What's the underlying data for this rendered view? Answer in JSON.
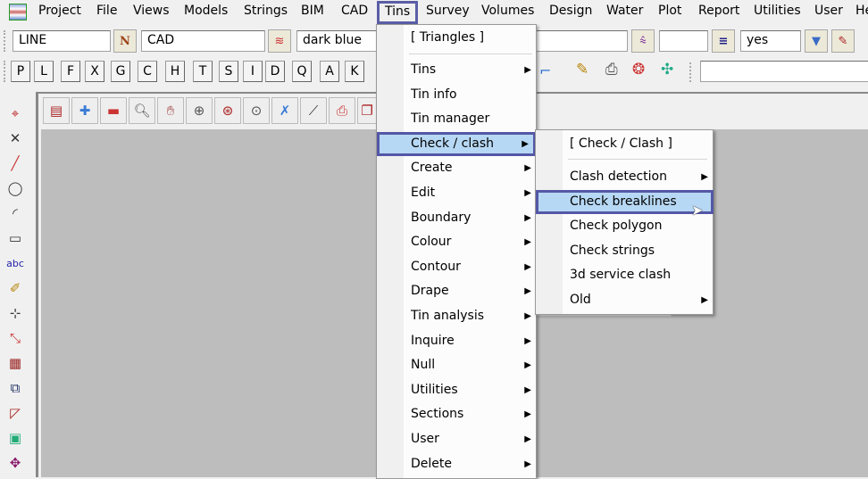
{
  "menubar": {
    "items": [
      "Project",
      "File",
      "Views",
      "Models",
      "Strings",
      "BIM",
      "CAD",
      "Tins",
      "Survey",
      "Volumes",
      "Design",
      "Water",
      "Plot",
      "Report",
      "Utilities",
      "User",
      "He"
    ],
    "active": "Tins"
  },
  "toolbar": {
    "line_value": "LINE",
    "model_value": "CAD",
    "colour_value": "dark blue",
    "flag_value": "yes",
    "n_button": "N"
  },
  "letters": [
    "P",
    "L",
    "F",
    "X",
    "G",
    "C",
    "H",
    "T",
    "S",
    "I",
    "D",
    "Q",
    "A",
    "K"
  ],
  "tins_menu": {
    "title": "[ Triangles ]",
    "items": [
      "Tins",
      "Tin info",
      "Tin manager",
      "Check / clash",
      "Create",
      "Edit",
      "Boundary",
      "Colour",
      "Contour",
      "Drape",
      "Tin analysis",
      "Inquire",
      "Null",
      "Utilities",
      "Sections",
      "User",
      "Delete"
    ],
    "submenu_flags": [
      true,
      false,
      false,
      true,
      true,
      true,
      true,
      true,
      true,
      true,
      true,
      true,
      true,
      true,
      true,
      true,
      true
    ],
    "highlighted": "Check / clash"
  },
  "check_menu": {
    "title": "[ Check / Clash ]",
    "items": [
      "Clash detection",
      "Check breaklines",
      "Check polygon",
      "Check strings",
      "3d service clash",
      "Old"
    ],
    "submenu_flags": [
      true,
      false,
      false,
      false,
      false,
      true
    ],
    "highlighted": "Check breaklines"
  },
  "colors": {
    "highlight": "#b7d8f4",
    "highlight_border": "#5457a6",
    "workspace": "#bdbdbd"
  }
}
